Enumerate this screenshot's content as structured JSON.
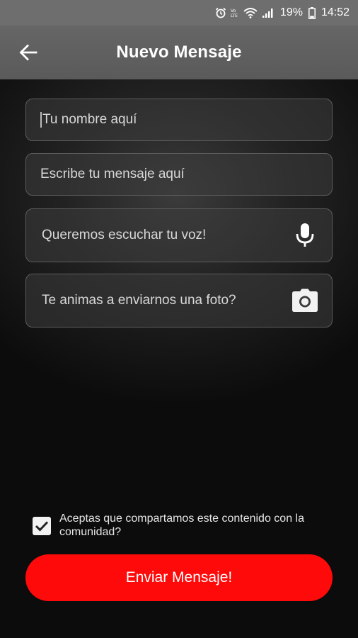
{
  "status_bar": {
    "battery": "19%",
    "time": "14:52"
  },
  "header": {
    "title": "Nuevo Mensaje"
  },
  "form": {
    "name_placeholder": "Tu nombre aquí",
    "message_placeholder": "Escribe tu mensaje aquí",
    "voice_placeholder": "Queremos escuchar tu voz!",
    "photo_placeholder": "Te animas a enviarnos una foto?"
  },
  "consent": {
    "label": "Aceptas que compartamos este contenido con la comunidad?",
    "checked": true
  },
  "submit": {
    "label": "Enviar Mensaje!"
  },
  "colors": {
    "accent": "#ff0a0a",
    "app_bar": "#5f5f5f"
  },
  "icons": {
    "back": "arrow-left",
    "voice": "microphone",
    "photo": "camera"
  }
}
